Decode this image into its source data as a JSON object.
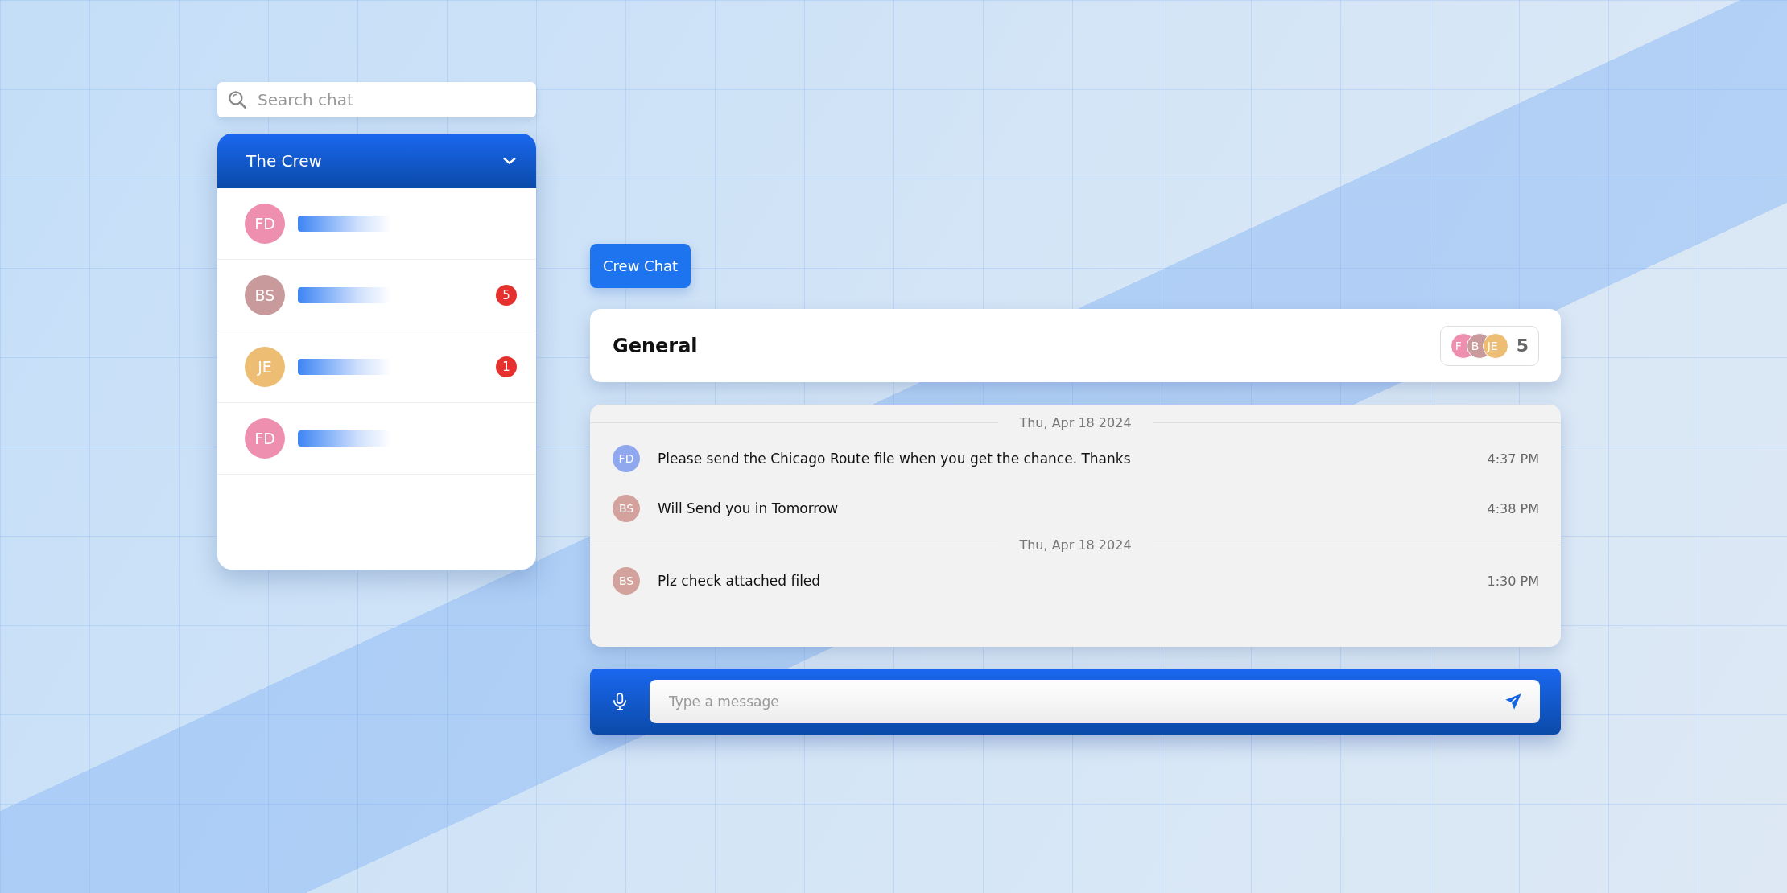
{
  "search": {
    "placeholder": "Search chat"
  },
  "group": {
    "title": "The Crew",
    "expanded": true
  },
  "contacts": [
    {
      "initials": "FD",
      "color": "#ef8fb0"
    },
    {
      "initials": "BS",
      "color": "#c99a9c",
      "unread": "5"
    },
    {
      "initials": "JE",
      "color": "#ecbd72",
      "unread": "1"
    },
    {
      "initials": "FD",
      "color": "#ef8fb0"
    }
  ],
  "chat_button": "Crew Chat",
  "channel": {
    "title": "General",
    "participants": [
      {
        "initials": "F",
        "color": "#ef8fb0"
      },
      {
        "initials": "B",
        "color": "#c99a9c"
      },
      {
        "initials": "JE",
        "color": "#ecbd72"
      }
    ],
    "count": "5"
  },
  "messages": [
    {
      "kind": "date",
      "text": "Thu, Apr 18 2024"
    },
    {
      "kind": "message",
      "initials": "FD",
      "color": "#8fa8ee",
      "text": "Please send the Chicago Route file when you get the chance. Thanks",
      "time": "4:37 PM"
    },
    {
      "kind": "message",
      "initials": "BS",
      "color": "#d4a29c",
      "text": "Will Send you in Tomorrow",
      "time": "4:38 PM"
    },
    {
      "kind": "date",
      "text": "Thu, Apr 18 2024"
    },
    {
      "kind": "message",
      "initials": "BS",
      "color": "#d4a29c",
      "text": "Plz check attached filed",
      "time": "1:30 PM"
    }
  ],
  "composer": {
    "placeholder": "Type a message"
  }
}
